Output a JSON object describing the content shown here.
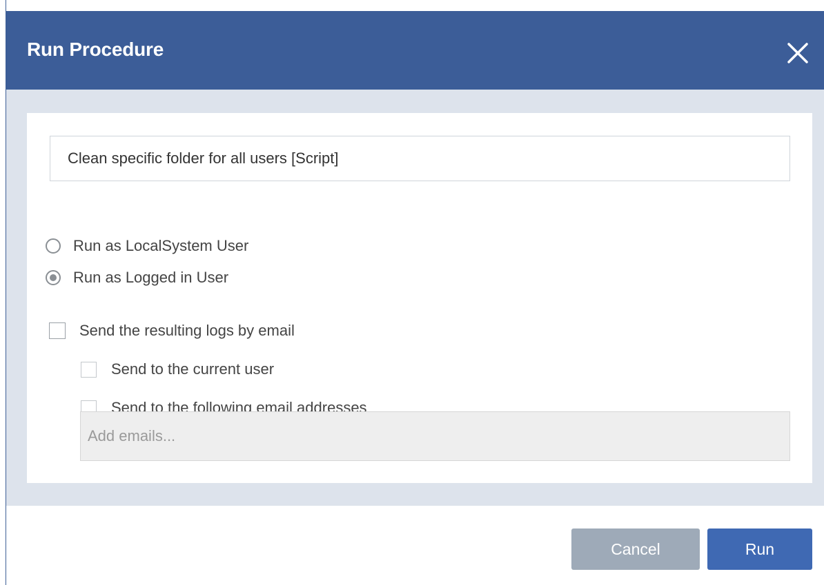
{
  "dialog": {
    "title": "Run Procedure",
    "close_icon": "close-icon"
  },
  "form": {
    "procedure_name": "Clean specific folder for all users [Script]",
    "run_options": [
      {
        "label": "Run as LocalSystem User",
        "checked": false
      },
      {
        "label": "Run as Logged in User",
        "checked": true
      }
    ],
    "send_logs": {
      "label": "Send the resulting logs by email",
      "checked": false
    },
    "send_current_user": {
      "label": "Send to the current user",
      "checked": false
    },
    "send_following": {
      "label": "Send to the following email addresses",
      "checked": false
    },
    "emails_placeholder": "Add emails..."
  },
  "footer": {
    "cancel_label": "Cancel",
    "run_label": "Run"
  },
  "colors": {
    "header": "#3c5d98",
    "run_button": "#3f69b3",
    "cancel_button": "#9eaab8"
  }
}
